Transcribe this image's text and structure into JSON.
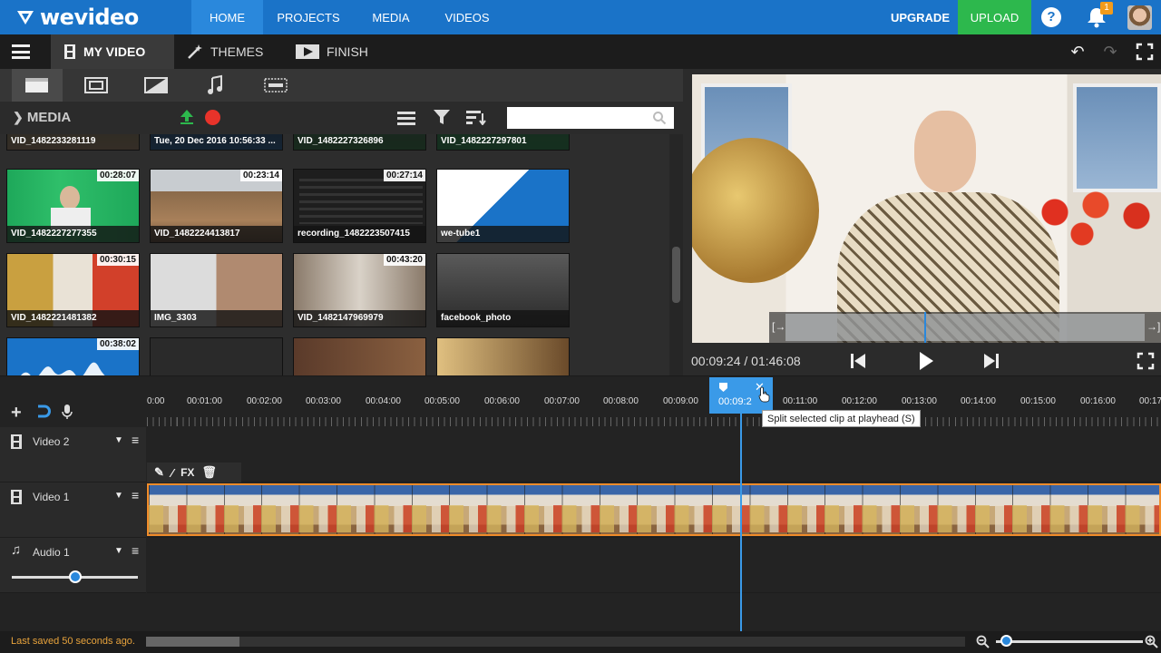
{
  "app": {
    "logo": "wevideo"
  },
  "nav": {
    "home": "HOME",
    "projects": "PROJECTS",
    "media": "MEDIA",
    "videos": "VIDEOS",
    "upgrade": "UPGRADE",
    "upload": "UPLOAD",
    "help": "?",
    "notifications": "1"
  },
  "tabs": {
    "my_video": "MY VIDEO",
    "themes": "THEMES",
    "finish": "FINISH"
  },
  "media": {
    "title": "MEDIA",
    "search_placeholder": "",
    "items": [
      {
        "label": "VID_1482233281119",
        "duration": ""
      },
      {
        "label": "Tue, 20 Dec 2016 10:56:33 ...",
        "duration": ""
      },
      {
        "label": "VID_1482227326896",
        "duration": ""
      },
      {
        "label": "VID_1482227297801",
        "duration": ""
      },
      {
        "label": "VID_1482227277355",
        "duration": "00:28:07"
      },
      {
        "label": "VID_1482224413817",
        "duration": "00:23:14"
      },
      {
        "label": "recording_1482223507415",
        "duration": "00:27:14"
      },
      {
        "label": "we-tube1",
        "duration": ""
      },
      {
        "label": "VID_1482221481382",
        "duration": "00:30:15"
      },
      {
        "label": "IMG_3303",
        "duration": ""
      },
      {
        "label": "VID_1482147969979",
        "duration": "00:43:20"
      },
      {
        "label": "facebook_photo",
        "duration": ""
      },
      {
        "label": "",
        "duration": "00:38:02"
      },
      {
        "label": "",
        "duration": ""
      },
      {
        "label": "",
        "duration": ""
      },
      {
        "label": "",
        "duration": ""
      }
    ]
  },
  "preview": {
    "timecode": "00:09:24 / 01:46:08"
  },
  "timeline": {
    "ticks": [
      "0:00",
      "00:01:00",
      "00:02:00",
      "00:03:00",
      "00:04:00",
      "00:05:00",
      "00:06:00",
      "00:07:00",
      "00:08:00",
      "00:09:00",
      "00:11:00",
      "00:12:00",
      "00:13:00",
      "00:14:00",
      "00:15:00",
      "00:16:00",
      "00:17"
    ],
    "playhead": "00:09:2",
    "tooltip": "Split selected clip at playhead (S)",
    "fx": "FX",
    "tracks": [
      {
        "name": "Video 2"
      },
      {
        "name": "Video 1"
      },
      {
        "name": "Audio 1"
      }
    ]
  },
  "status": {
    "saved": "Last saved 50 seconds ago."
  },
  "colors": {
    "brand": "#1a73c8",
    "upload": "#2db84d",
    "accent": "#3a9ae8",
    "clip_border": "#f08c2a"
  }
}
